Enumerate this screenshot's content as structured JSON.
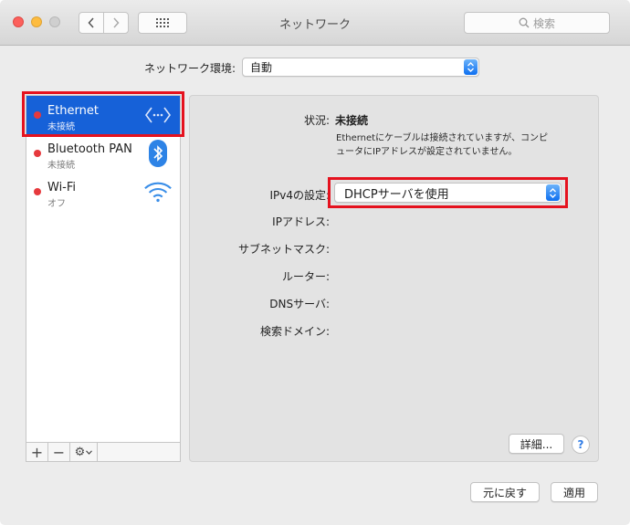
{
  "window": {
    "title": "ネットワーク"
  },
  "search": {
    "placeholder": "検索"
  },
  "location": {
    "label": "ネットワーク環境:",
    "value": "自動"
  },
  "services": [
    {
      "name": "Ethernet",
      "status": "未接続",
      "icon": "ethernet-arrows-icon",
      "selected": true
    },
    {
      "name": "Bluetooth PAN",
      "status": "未接続",
      "icon": "bluetooth-icon",
      "selected": false
    },
    {
      "name": "Wi-Fi",
      "status": "オフ",
      "icon": "wifi-icon",
      "selected": false
    }
  ],
  "sidebar_tools": {
    "add": "+",
    "remove": "−",
    "gear": "⚙"
  },
  "detail": {
    "status_label": "状況:",
    "status_value": "未接続",
    "status_description": "Ethernetにケーブルは接続されていますが、コンピュータにIPアドレスが設定されていません。",
    "ipv4_label": "IPv4の設定:",
    "ipv4_value": "DHCPサーバを使用",
    "ip_label": "IPアドレス:",
    "subnet_label": "サブネットマスク:",
    "router_label": "ルーター:",
    "dns_label": "DNSサーバ:",
    "search_domain_label": "検索ドメイン:"
  },
  "buttons": {
    "advanced": "詳細...",
    "help": "?",
    "revert": "元に戻す",
    "apply": "適用"
  },
  "colors": {
    "selection": "#1661d8",
    "status_dot": "#e6393d",
    "highlight": "#e5121e",
    "popup_stepper": "#0e6ff0"
  }
}
